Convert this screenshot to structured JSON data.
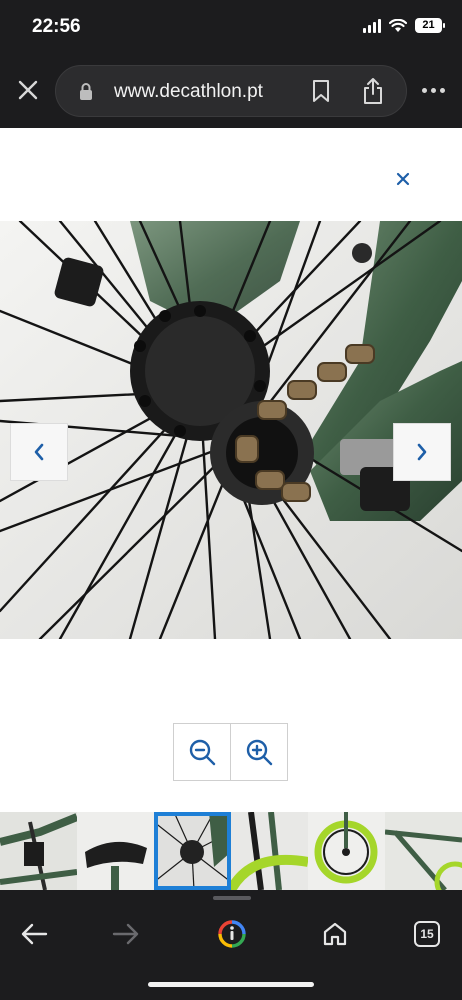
{
  "status_bar": {
    "time": "22:56",
    "battery": "21"
  },
  "browser": {
    "url": "www.decathlon.pt",
    "tab_count": "15"
  },
  "gallery": {
    "active_thumbnail": 3,
    "thumbnail_count": 6
  },
  "colors": {
    "accent": "#1e5fa8",
    "active_outline": "#1e7fd6",
    "frame_green": "#3f5e45",
    "dark_chrome": "#1c1c1e"
  },
  "icons": [
    "close-icon",
    "lock-icon",
    "bookmark-icon",
    "share-icon",
    "more-icon",
    "chevron-left-icon",
    "chevron-right-icon",
    "zoom-out-icon",
    "zoom-in-icon",
    "back-arrow-icon",
    "forward-arrow-icon",
    "google-icon",
    "home-icon"
  ]
}
